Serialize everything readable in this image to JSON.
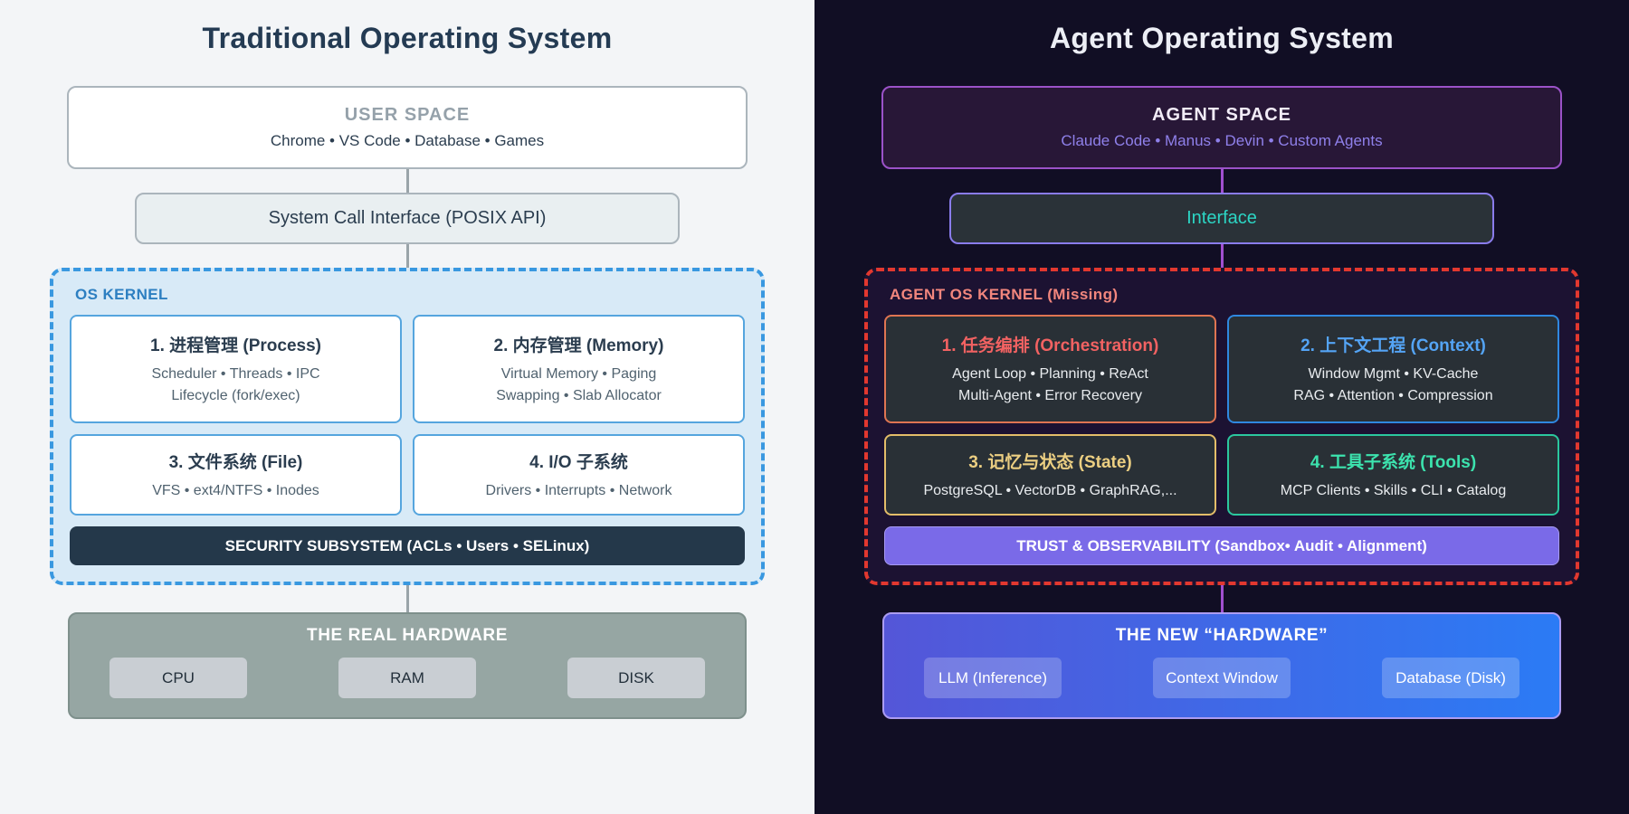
{
  "left": {
    "title": "Traditional Operating System",
    "user_space": {
      "label": "USER SPACE",
      "apps": "Chrome • VS Code • Database • Games"
    },
    "syscall": "System Call Interface (POSIX API)",
    "kernel": {
      "label": "OS KERNEL",
      "cards": [
        {
          "title": "1. 进程管理 (Process)",
          "line1": "Scheduler • Threads • IPC",
          "line2": "Lifecycle (fork/exec)"
        },
        {
          "title": "2. 内存管理 (Memory)",
          "line1": "Virtual Memory • Paging",
          "line2": "Swapping • Slab Allocator"
        },
        {
          "title": "3. 文件系统 (File)",
          "line1": "VFS • ext4/NTFS • Inodes",
          "line2": ""
        },
        {
          "title": "4. I/O 子系统",
          "line1": "Drivers • Interrupts • Network",
          "line2": ""
        }
      ],
      "bar": "SECURITY SUBSYSTEM (ACLs • Users • SELinux)"
    },
    "hardware": {
      "title": "THE REAL HARDWARE",
      "chips": [
        "CPU",
        "RAM",
        "DISK"
      ]
    }
  },
  "right": {
    "title": "Agent Operating System",
    "agent_space": {
      "label": "AGENT SPACE",
      "apps": "Claude Code • Manus • Devin • Custom Agents"
    },
    "interface": "Interface",
    "kernel": {
      "label": "AGENT OS KERNEL (Missing)",
      "cards": [
        {
          "title": "1. 任务编排 (Orchestration)",
          "line1": "Agent Loop • Planning • ReAct",
          "line2": "Multi-Agent • Error Recovery"
        },
        {
          "title": "2. 上下文工程 (Context)",
          "line1": "Window Mgmt • KV-Cache",
          "line2": "RAG • Attention • Compression"
        },
        {
          "title": "3. 记忆与状态 (State)",
          "line1": "PostgreSQL • VectorDB • GraphRAG,...",
          "line2": ""
        },
        {
          "title": "4. 工具子系统 (Tools)",
          "line1": "MCP Clients • Skills • CLI •  Catalog",
          "line2": ""
        }
      ],
      "bar": "TRUST & OBSERVABILITY (Sandbox• Audit • Alignment)"
    },
    "hardware": {
      "title": "THE NEW “HARDWARE”",
      "chips": [
        "LLM (Inference)",
        "Context Window",
        "Database (Disk)"
      ]
    }
  },
  "colors": {
    "left_background": "#f3f5f7",
    "left_title_text": "#243b53",
    "left_kernel_fill": "#d8eaf7",
    "left_kernel_dash": "#3998e0",
    "left_security_bar": "#24384a",
    "left_hardware_fill": "#96a6a3",
    "right_background": "#110e24",
    "agent_space_border": "#9b52c8",
    "interface_text": "#2cd5c4",
    "right_kernel_dash": "#e2382f",
    "kernel_missing_label": "#f2867d",
    "card1_accent": "#f26262",
    "card2_accent": "#54a4f5",
    "card3_accent": "#eccf82",
    "card4_accent": "#3ce3ae",
    "trust_bar": "#7a6ae8",
    "right_hardware_gradient_start": "#5456d8",
    "right_hardware_gradient_end": "#2b7bf5",
    "left_connector": "#9aa4a9",
    "right_connector": "#a14fd0"
  }
}
